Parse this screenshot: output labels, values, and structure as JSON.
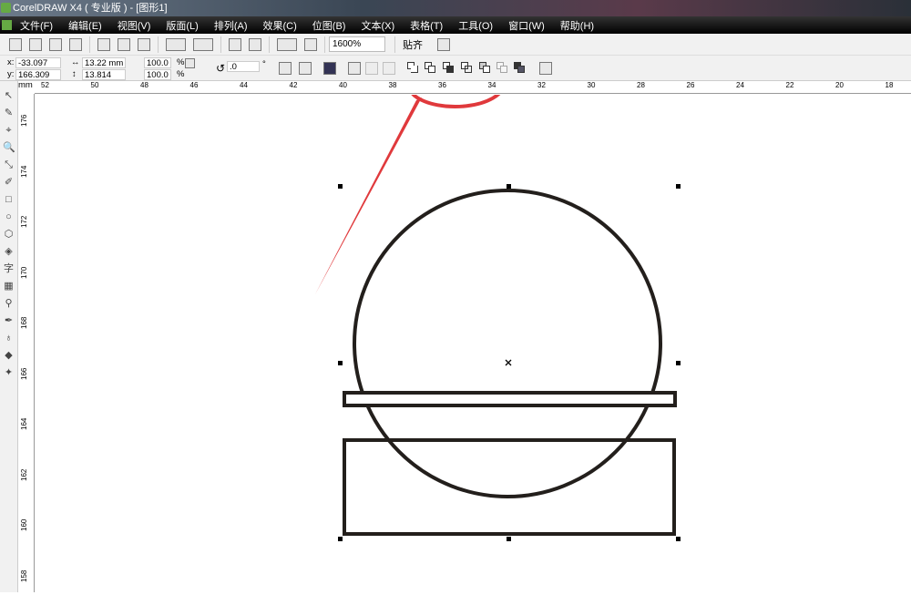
{
  "window": {
    "title": "CorelDRAW X4 ( 专业版 ) - [图形1]"
  },
  "menu": [
    "文件(F)",
    "编辑(E)",
    "视图(V)",
    "版面(L)",
    "排列(A)",
    "效果(C)",
    "位图(B)",
    "文本(X)",
    "表格(T)",
    "工具(O)",
    "窗口(W)",
    "帮助(H)"
  ],
  "toolbar": {
    "zoom": "1600%",
    "snap": "贴齐"
  },
  "props": {
    "x_label": "x:",
    "x": "-33.097 mm",
    "y_label": "y:",
    "y": "166.309 mm",
    "width": "13.22 mm",
    "height": "13.814 mm",
    "scale_x": "100.0",
    "scale_y": "100.0",
    "pct": "%",
    "rotation": ".0",
    "deg": "°"
  },
  "ruler_h": [
    "52",
    "50",
    "48",
    "46",
    "44",
    "42",
    "40",
    "38",
    "36",
    "34",
    "32",
    "30",
    "28",
    "26",
    "24",
    "22",
    "20",
    "18"
  ],
  "ruler_v": [
    "176",
    "174",
    "172",
    "170",
    "168",
    "166",
    "164",
    "162",
    "160",
    "158"
  ],
  "tools": [
    "↖",
    "✎",
    "⌖",
    "🔍",
    "⤡",
    "✐",
    "□",
    "○",
    "⬡",
    "◈",
    "字",
    "▦",
    "⚲",
    "✒",
    "♁",
    "◆",
    "✦"
  ],
  "colors": {
    "annotation": "#e0393c",
    "shape_stroke": "#231f1c"
  }
}
